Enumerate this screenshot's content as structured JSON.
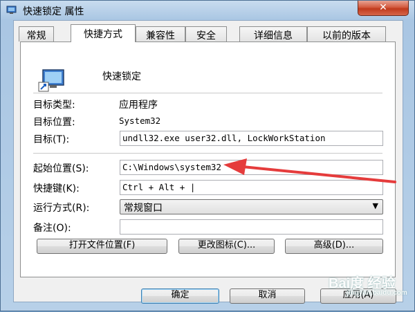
{
  "window": {
    "title": "快速锁定 属性",
    "close": "✕"
  },
  "tabs": [
    "常规",
    "快捷方式",
    "兼容性",
    "安全",
    "详细信息",
    "以前的版本"
  ],
  "header": {
    "name": "快速锁定"
  },
  "fields": {
    "target_type": {
      "label": "目标类型:",
      "value": "应用程序"
    },
    "target_location": {
      "label": "目标位置:",
      "value": "System32"
    },
    "target": {
      "label": "目标(T):",
      "value": "undll32.exe user32.dll, LockWorkStation"
    },
    "start_in": {
      "label": "起始位置(S):",
      "value": "C:\\Windows\\system32"
    },
    "shortcut_key": {
      "label": "快捷键(K):",
      "value": "Ctrl + Alt + |"
    },
    "run": {
      "label": "运行方式(R):",
      "value": "常规窗口"
    },
    "comment": {
      "label": "备注(O):",
      "value": ""
    }
  },
  "buttons": {
    "open_location": "打开文件位置(F)",
    "change_icon": "更改图标(C)...",
    "advanced": "高级(D)...",
    "ok": "确定",
    "cancel": "取消",
    "apply": "应用(A)"
  },
  "watermark": {
    "brand": "Bai度 经验",
    "url": "jingyan.baidu.com"
  },
  "colors": {
    "accent": "#e53c3c",
    "title_bar": "#a9c6e3",
    "close_button": "#c03a1d"
  }
}
